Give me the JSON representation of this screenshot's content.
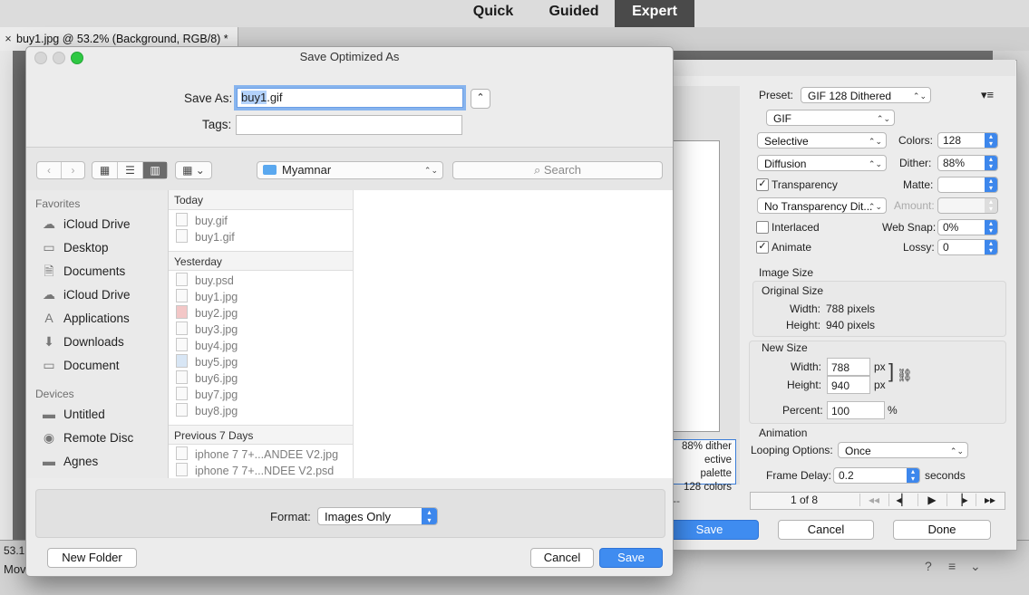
{
  "app": {
    "modes": [
      "Quick",
      "Guided",
      "Expert"
    ],
    "active_mode": "Expert",
    "doc_tab": "buy1.jpg @ 53.2% (Background, RGB/8) *",
    "doc_tab_close": "×",
    "zoom": "53.1",
    "status": "Mov"
  },
  "sfw": {
    "preset_label": "Preset:",
    "preset_value": "GIF 128 Dithered",
    "format_value": "GIF",
    "reduction_value": "Selective",
    "colors_label": "Colors:",
    "colors_value": "128",
    "dither_algo": "Diffusion",
    "dither_label": "Dither:",
    "dither_value": "88%",
    "transparency_label": "Transparency",
    "transparency_checked": true,
    "matte_label": "Matte:",
    "trans_dither": "No Transparency Dit...",
    "amount_label": "Amount:",
    "interlaced_label": "Interlaced",
    "interlaced_checked": false,
    "websnap_label": "Web Snap:",
    "websnap_value": "0%",
    "animate_label": "Animate",
    "animate_checked": true,
    "lossy_label": "Lossy:",
    "lossy_value": "0",
    "image_size_label": "Image Size",
    "original_size_label": "Original Size",
    "orig_width_label": "Width:",
    "orig_width_value": "788 pixels",
    "orig_height_label": "Height:",
    "orig_height_value": "940 pixels",
    "new_size_label": "New Size",
    "new_width_label": "Width:",
    "new_width_value": "788",
    "new_height_label": "Height:",
    "new_height_value": "940",
    "unit_px": "px",
    "percent_label": "Percent:",
    "percent_value": "100",
    "percent_unit": "%",
    "animation_label": "Animation",
    "looping_label": "Looping Options:",
    "looping_value": "Once",
    "frame_delay_label": "Frame Delay:",
    "frame_delay_value": "0.2",
    "seconds_label": "seconds",
    "frame_counter": "1 of 8",
    "preview_info": [
      "88% dither",
      "ective palette",
      "128 colors"
    ],
    "preview_dash": "--",
    "save_label": "Save",
    "cancel_label": "Cancel",
    "done_label": "Done"
  },
  "dialog": {
    "title": "Save Optimized As",
    "save_as_label": "Save As:",
    "filename_selected": "buy1",
    "filename_ext": ".gif",
    "tags_label": "Tags:",
    "tags_value": "",
    "location": "Myamnar",
    "search_placeholder": "Search",
    "sidebar": {
      "favorites_title": "Favorites",
      "favorites": [
        {
          "label": "iCloud Drive",
          "icon": "cloud-icon"
        },
        {
          "label": "Desktop",
          "icon": "desktop-icon"
        },
        {
          "label": "Documents",
          "icon": "document-icon"
        },
        {
          "label": "iCloud Drive",
          "icon": "cloud-icon"
        },
        {
          "label": "Applications",
          "icon": "applications-icon"
        },
        {
          "label": "Downloads",
          "icon": "download-icon"
        },
        {
          "label": "Document",
          "icon": "folder-icon"
        }
      ],
      "devices_title": "Devices",
      "devices": [
        {
          "label": "Untitled",
          "icon": "disk-icon"
        },
        {
          "label": "Remote Disc",
          "icon": "disc-icon"
        },
        {
          "label": "Agnes",
          "icon": "disk-icon"
        }
      ]
    },
    "groups": [
      {
        "title": "Today",
        "files": [
          "buy.gif",
          "buy1.gif"
        ]
      },
      {
        "title": "Yesterday",
        "files": [
          "buy.psd",
          "buy1.jpg",
          "buy2.jpg",
          "buy3.jpg",
          "buy4.jpg",
          "buy5.jpg",
          "buy6.jpg",
          "buy7.jpg",
          "buy8.jpg"
        ]
      },
      {
        "title": "Previous 7 Days",
        "files": [
          "iphone 7 7+...ANDEE V2.jpg",
          "iphone 7 7+...NDEE V2.psd"
        ]
      }
    ],
    "format_label": "Format:",
    "format_value": "Images Only",
    "new_folder_label": "New Folder",
    "cancel_label": "Cancel",
    "save_label": "Save"
  }
}
